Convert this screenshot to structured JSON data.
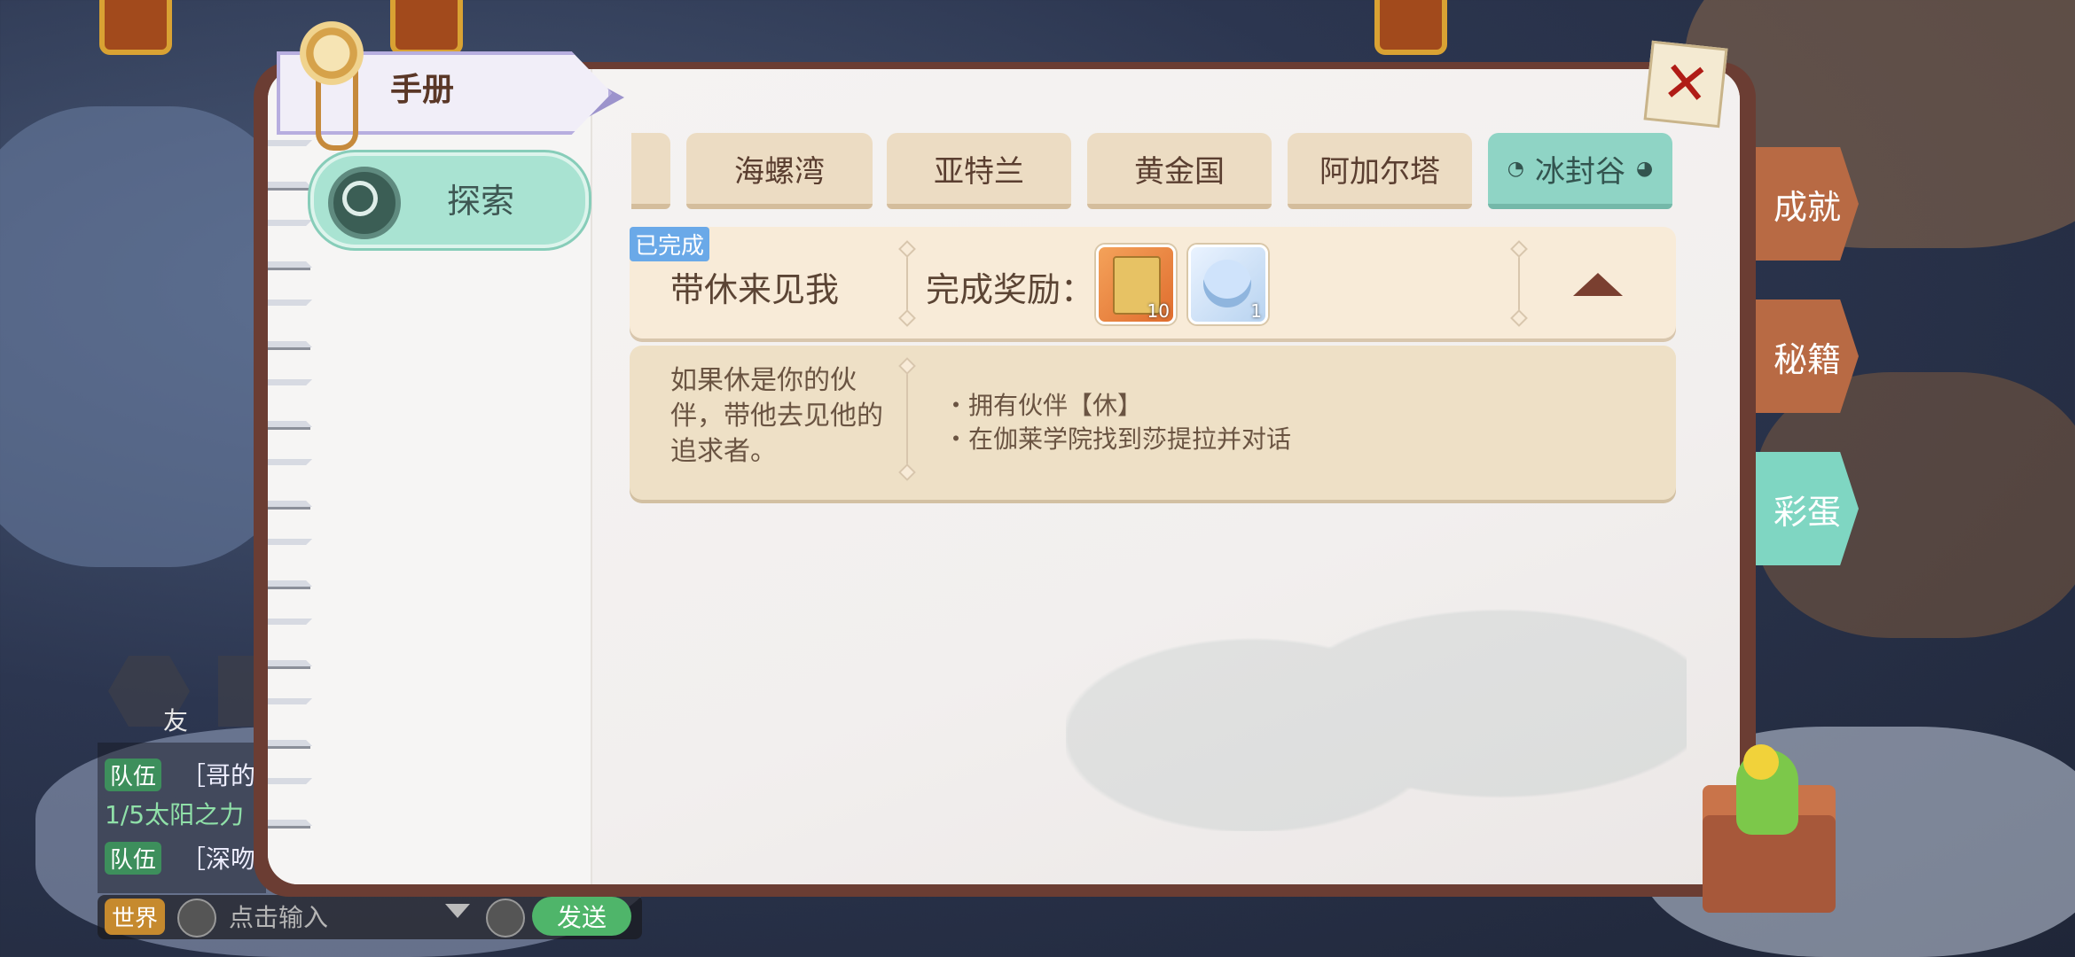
{
  "handbook": {
    "title": "手册"
  },
  "left_nav": {
    "explore_label": "探索"
  },
  "region_tabs": [
    {
      "label": "海螺湾",
      "active": false
    },
    {
      "label": "亚特兰",
      "active": false
    },
    {
      "label": "黄金国",
      "active": false
    },
    {
      "label": "阿加尔塔",
      "active": false
    },
    {
      "label": "冰封谷",
      "active": true
    }
  ],
  "quest": {
    "status_badge": "已完成",
    "title": "带休来见我",
    "reward_label": "完成奖励：",
    "rewards": [
      {
        "icon": "treasure-map-scroll-icon",
        "count": "10"
      },
      {
        "icon": "ice-figure-icon",
        "count": "1"
      }
    ],
    "description": "如果休是你的伙伴，带他去见他的追求者。",
    "requirements": [
      "・拥有伙伴【休】",
      "・在伽莱学院找到莎提拉并对话"
    ]
  },
  "side_tabs": [
    {
      "label": "成就",
      "active": false
    },
    {
      "label": "秘籍",
      "active": false
    },
    {
      "label": "彩蛋",
      "active": true
    }
  ],
  "chat": {
    "friend_label": "友",
    "lines": [
      {
        "tag": "队伍",
        "text": "［哥的"
      },
      {
        "tag": "",
        "text": "1/5太阳之力"
      },
      {
        "tag": "队伍",
        "text": "［深吻"
      }
    ],
    "channel": "世界",
    "input_placeholder": "点击输入",
    "send_label": "发送"
  },
  "colors": {
    "accent_green": "#8fd4c5",
    "tab_beige": "#ecdcc3",
    "book_border": "#6b3d33",
    "done_badge": "#6aa9e8"
  }
}
